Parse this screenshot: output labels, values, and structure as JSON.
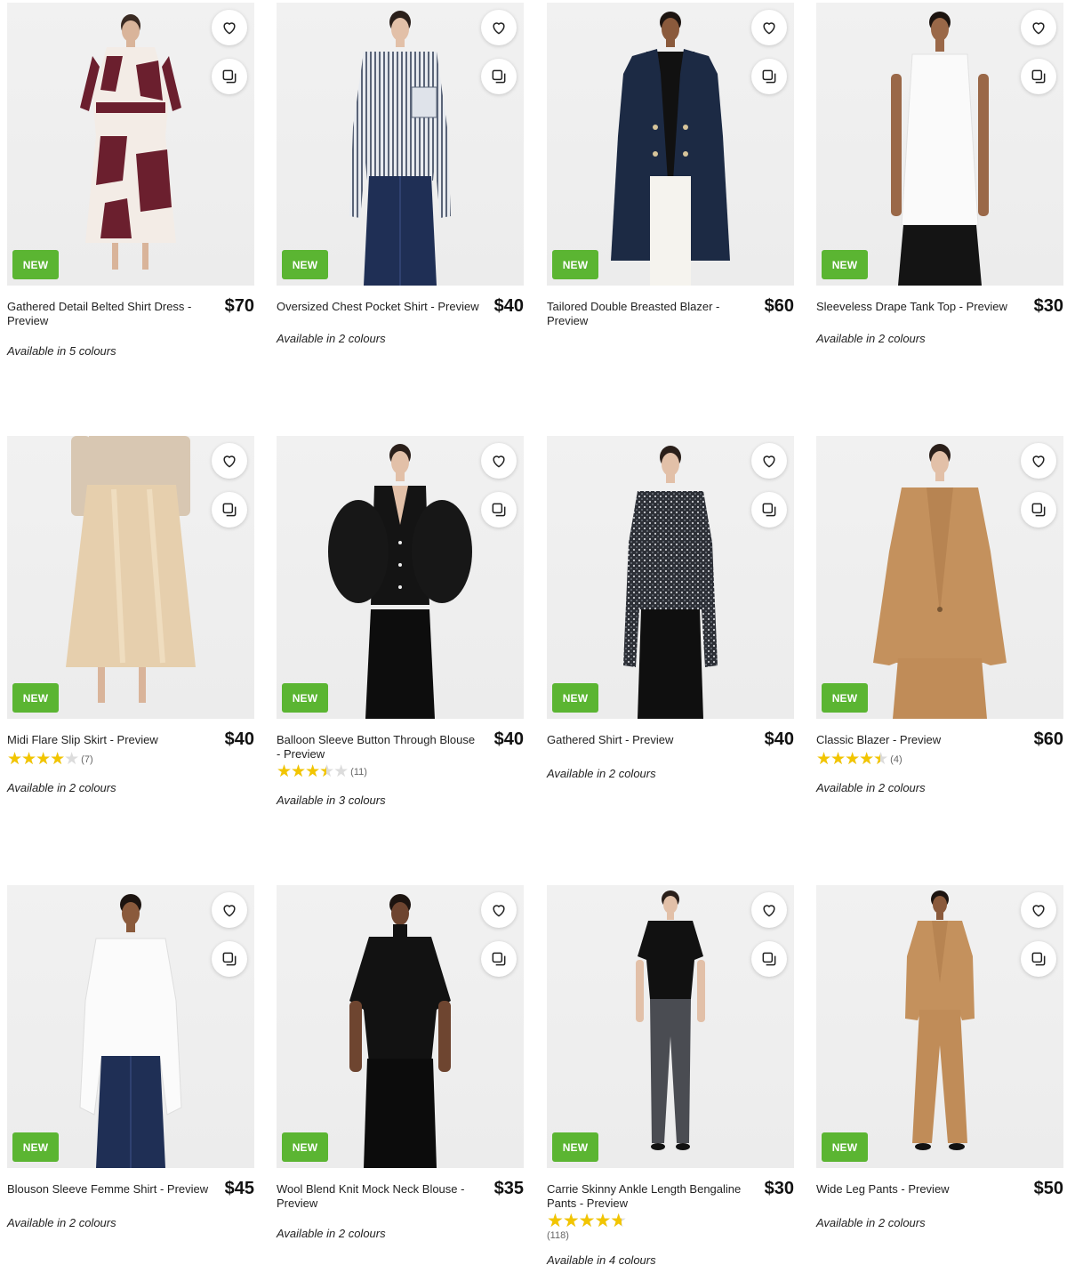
{
  "badge_label": "NEW",
  "colors": {
    "badge_green": "#5bb532",
    "star_yellow": "#f2c500"
  },
  "icons": {
    "wishlist": "heart-icon",
    "compare": "compare-icon"
  },
  "products": [
    {
      "title": "Gathered Detail Belted Shirt Dress - Preview",
      "price": "$70",
      "colours": "Available in 5 colours",
      "badge": "NEW",
      "rating": null,
      "reviews": null
    },
    {
      "title": "Oversized Chest Pocket Shirt - Preview",
      "price": "$40",
      "colours": "Available in 2 colours",
      "badge": "NEW",
      "rating": null,
      "reviews": null
    },
    {
      "title": "Tailored Double Breasted Blazer - Preview",
      "price": "$60",
      "colours": "",
      "badge": "NEW",
      "rating": null,
      "reviews": null
    },
    {
      "title": "Sleeveless Drape Tank Top - Preview",
      "price": "$30",
      "colours": "Available in 2 colours",
      "badge": "NEW",
      "rating": null,
      "reviews": null
    },
    {
      "title": "Midi Flare Slip Skirt - Preview",
      "price": "$40",
      "colours": "Available in 2 colours",
      "badge": "NEW",
      "rating": 4.0,
      "reviews": "(7)"
    },
    {
      "title": "Balloon Sleeve Button Through Blouse - Preview",
      "price": "$40",
      "colours": "Available in 3 colours",
      "badge": "NEW",
      "rating": 3.5,
      "reviews": "(11)"
    },
    {
      "title": "Gathered Shirt - Preview",
      "price": "$40",
      "colours": "Available in 2 colours",
      "badge": "NEW",
      "rating": null,
      "reviews": null
    },
    {
      "title": "Classic Blazer - Preview",
      "price": "$60",
      "colours": "Available in 2 colours",
      "badge": "NEW",
      "rating": 4.5,
      "reviews": "(4)"
    },
    {
      "title": "Blouson Sleeve Femme Shirt - Preview",
      "price": "$45",
      "colours": "Available in 2 colours",
      "badge": "NEW",
      "rating": null,
      "reviews": null
    },
    {
      "title": "Wool Blend Knit Mock Neck Blouse - Preview",
      "price": "$35",
      "colours": "Available in 2 colours",
      "badge": "NEW",
      "rating": null,
      "reviews": null
    },
    {
      "title": "Carrie Skinny Ankle Length Bengaline Pants - Preview",
      "price": "$30",
      "colours": "Available in 4 colours",
      "badge": "NEW",
      "rating": 4.7,
      "reviews": "(118)"
    },
    {
      "title": "Wide Leg Pants - Preview",
      "price": "$50",
      "colours": "Available in 2 colours",
      "badge": "NEW",
      "rating": null,
      "reviews": null
    }
  ]
}
